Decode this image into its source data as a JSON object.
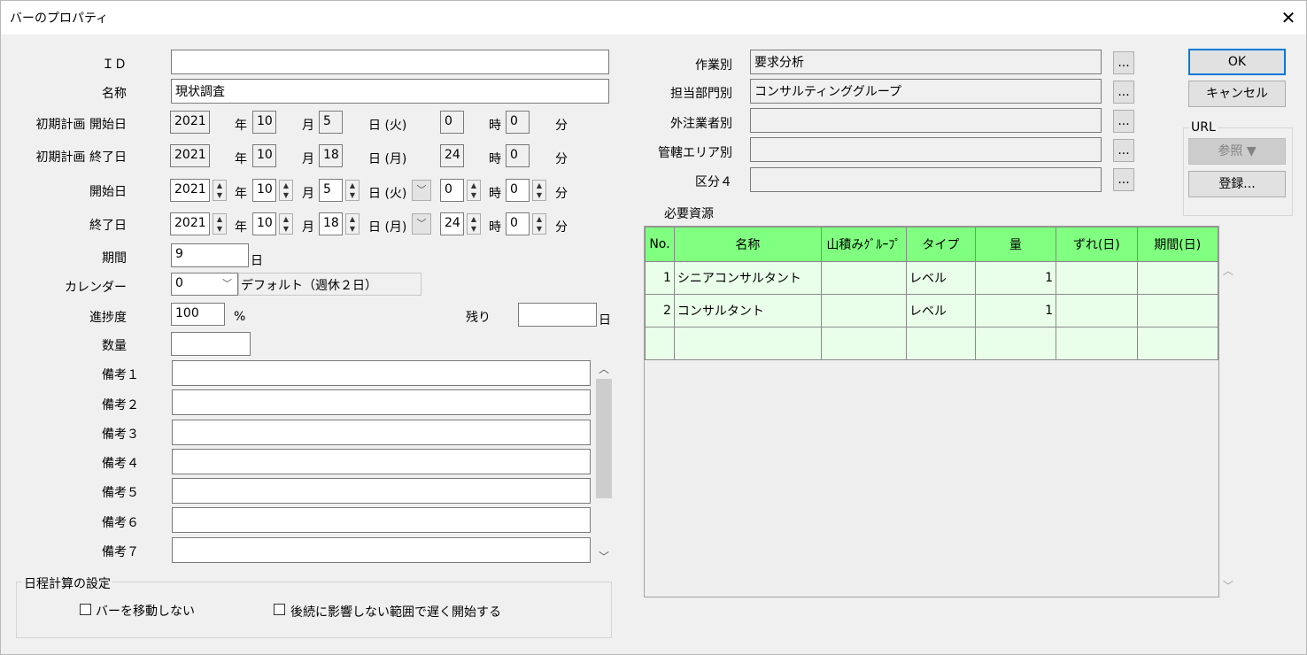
{
  "window": {
    "title": "バーのプロパティ",
    "close_glyph": "✕"
  },
  "left": {
    "id_label": "ＩＤ",
    "id_value": "",
    "name_label": "名称",
    "name_value": "現状調査",
    "init_start_label": "初期計画 開始日",
    "init_start": {
      "year": "2021",
      "month": "10",
      "day": "5",
      "weekday": "日 (火)",
      "hour": "0",
      "min": "0"
    },
    "init_end_label": "初期計画 終了日",
    "init_end": {
      "year": "2021",
      "month": "10",
      "day": "18",
      "weekday": "日 (月)",
      "hour": "24",
      "min": "0"
    },
    "start_label": "開始日",
    "start": {
      "year": "2021",
      "month": "10",
      "day": "5",
      "weekday": "日 (火)",
      "hour": "0",
      "min": "0"
    },
    "end_label": "終了日",
    "end": {
      "year": "2021",
      "month": "10",
      "day": "18",
      "weekday": "日 (月)",
      "hour": "24",
      "min": "0"
    },
    "unit_year": "年",
    "unit_month": "月",
    "unit_hour": "時",
    "unit_min": "分",
    "period_label": "期間",
    "period_value": "9",
    "period_unit": "日",
    "calendar_label": "カレンダー",
    "calendar_value": "0",
    "calendar_name": "デフォルト（週休２日）",
    "progress_label": "進捗度",
    "progress_value": "100",
    "progress_unit": "%",
    "remaining_label": "残り",
    "remaining_value": "",
    "remaining_unit": "日",
    "quantity_label": "数量",
    "quantity_value": "",
    "notes": [
      {
        "label": "備考１",
        "value": ""
      },
      {
        "label": "備考２",
        "value": ""
      },
      {
        "label": "備考３",
        "value": ""
      },
      {
        "label": "備考４",
        "value": ""
      },
      {
        "label": "備考５",
        "value": ""
      },
      {
        "label": "備考６",
        "value": ""
      },
      {
        "label": "備考７",
        "value": ""
      }
    ]
  },
  "schedule_group": {
    "title": "日程計算の設定",
    "option1": "バーを移動しない",
    "option2": "後続に影響しない範囲で遅く開始する"
  },
  "right": {
    "work_label": "作業別",
    "work_value": "要求分析",
    "dept_label": "担当部門別",
    "dept_value": "コンサルティンググループ",
    "vendor_label": "外注業者別",
    "vendor_value": "",
    "area_label": "管轄エリア別",
    "area_value": "",
    "class4_label": "区分４",
    "class4_value": "",
    "ellipsis": "...",
    "resources_label": "必要資源",
    "grid_headers": [
      "No.",
      "名称",
      "山積みｸﾞﾙｰﾌﾟ",
      "タイプ",
      "量",
      "ずれ(日)",
      "期間(日)"
    ],
    "grid_rows": [
      [
        "1",
        "シニアコンサルタント",
        "",
        "レベル",
        "1",
        "",
        ""
      ],
      [
        "2",
        "コンサルタント",
        "",
        "レベル",
        "1",
        "",
        ""
      ],
      [
        "",
        "",
        "",
        "",
        "",
        "",
        ""
      ]
    ]
  },
  "buttons": {
    "ok": "OK",
    "cancel": "キャンセル",
    "url_group": "URL",
    "browse": "参照 ▼",
    "register": "登録..."
  }
}
